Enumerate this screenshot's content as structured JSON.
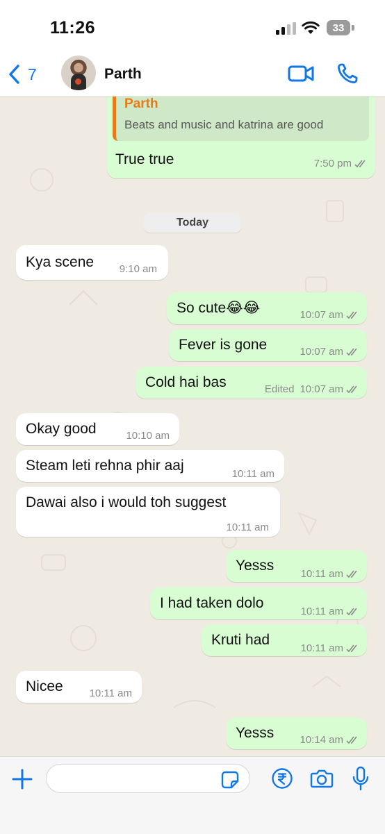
{
  "status_bar": {
    "time": "11:26",
    "battery": "33"
  },
  "header": {
    "back_count": "7",
    "contact_name": "Parth"
  },
  "day_separator": "Today",
  "quoted_message": {
    "author": "Parth",
    "text": "Beats and music and katrina are good",
    "reply": "True true",
    "time": "7:50 pm"
  },
  "messages": [
    {
      "dir": "in",
      "text": "Kya scene",
      "time": "9:10 am"
    },
    {
      "dir": "out",
      "text": "So cute😂😂",
      "time": "10:07 am"
    },
    {
      "dir": "out",
      "text": "Fever is gone",
      "time": "10:07 am"
    },
    {
      "dir": "out",
      "text": "Cold hai bas",
      "edited": "Edited",
      "time": "10:07 am"
    },
    {
      "dir": "in",
      "text": "Okay good",
      "time": "10:10 am"
    },
    {
      "dir": "in",
      "text": "Steam leti rehna phir aaj",
      "time": "10:11 am"
    },
    {
      "dir": "in",
      "text": "Dawai also i would toh suggest",
      "time": "10:11 am"
    },
    {
      "dir": "out",
      "text": "Yesss",
      "time": "10:11 am"
    },
    {
      "dir": "out",
      "text": "I had taken dolo",
      "time": "10:11 am"
    },
    {
      "dir": "out",
      "text": "Kruti had",
      "time": "10:11 am"
    },
    {
      "dir": "in",
      "text": "Nicee",
      "time": "10:11 am"
    },
    {
      "dir": "out",
      "text": "Yesss",
      "time": "10:14 am"
    }
  ],
  "colors": {
    "accent": "#1277e6",
    "outgoing_bubble": "#d9fdd3",
    "incoming_bubble": "#ffffff",
    "chat_background": "#efeae2",
    "quote_author": "#e57c17"
  },
  "icons": {
    "back": "chevron-left-icon",
    "video": "video-camera-icon",
    "call": "phone-icon",
    "attach": "plus-icon",
    "sticker": "sticker-icon",
    "payment": "rupee-icon",
    "camera": "camera-icon",
    "voice": "microphone-icon",
    "read": "double-check-icon"
  }
}
